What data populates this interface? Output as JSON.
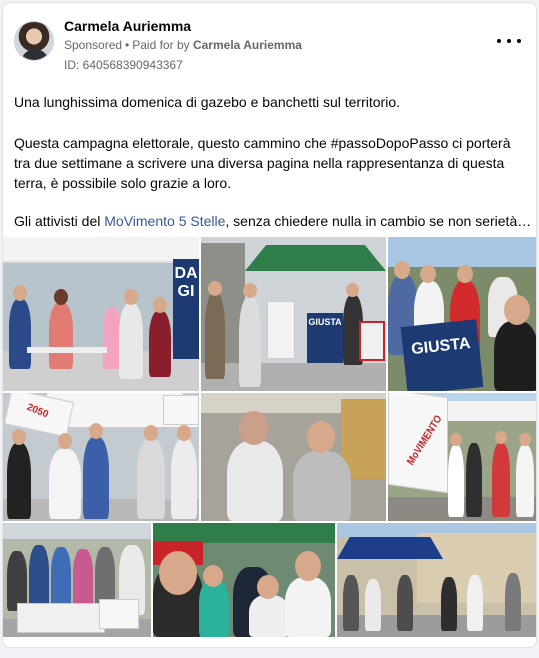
{
  "post": {
    "author": "Carmela Auriemma",
    "sponsored_label": "Sponsored",
    "paid_for_prefix": "Paid for by",
    "paid_for_name": "Carmela Auriemma",
    "ad_id": "ID: 640568390943367",
    "more_icon": "ellipsis-icon",
    "paragraph_1": "Una lunghissima domenica di gazebo e banchetti sul territorio.",
    "paragraph_2": "Questa campagna elettorale, questo cammino che #passoDopoPasso ci porterà tra due settimane a scrivere una diversa pagina nella rappresentanza di questa terra, è possibile solo grazie a loro.",
    "paragraph_3_prefix": "Gli attivisti del ",
    "paragraph_3_link": "MoVimento 5 Stelle",
    "paragraph_3_suffix": ", senza chiedere nulla in cambio se non serietà…"
  },
  "photos": {
    "sign_giusta": "GIUSTA",
    "sign_da": "DA",
    "sign_gi": "GI",
    "flag_text": "MoVIMENTO",
    "flag_2050": "2050",
    "tent_color": "#2f7d4a",
    "banner_color": "#1d3a73"
  }
}
